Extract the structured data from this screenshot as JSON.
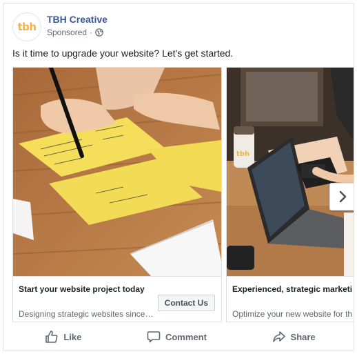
{
  "page": {
    "name": "TBH Creative",
    "avatar_text": "tbh",
    "sponsored": "Sponsored",
    "separator": "·",
    "brand_color": "#f3b23a"
  },
  "post": {
    "text": "Is it time to upgrade your website? Let's get started."
  },
  "carousel": {
    "slides": [
      {
        "image": "hand-writing-on-yellow-notes",
        "headline": "Start your website project today",
        "description": "Designing strategic websites since…",
        "cta": "Contact Us"
      },
      {
        "image": "woman-using-laptop-with-tbh-cup",
        "headline": "Experienced, strategic marketi",
        "description": "Optimize your new website for th"
      }
    ],
    "next_icon": "chevron-right-icon"
  },
  "actions": [
    {
      "label": "Like",
      "icon": "thumbs-up-icon"
    },
    {
      "label": "Comment",
      "icon": "comment-icon"
    },
    {
      "label": "Share",
      "icon": "share-icon"
    }
  ]
}
